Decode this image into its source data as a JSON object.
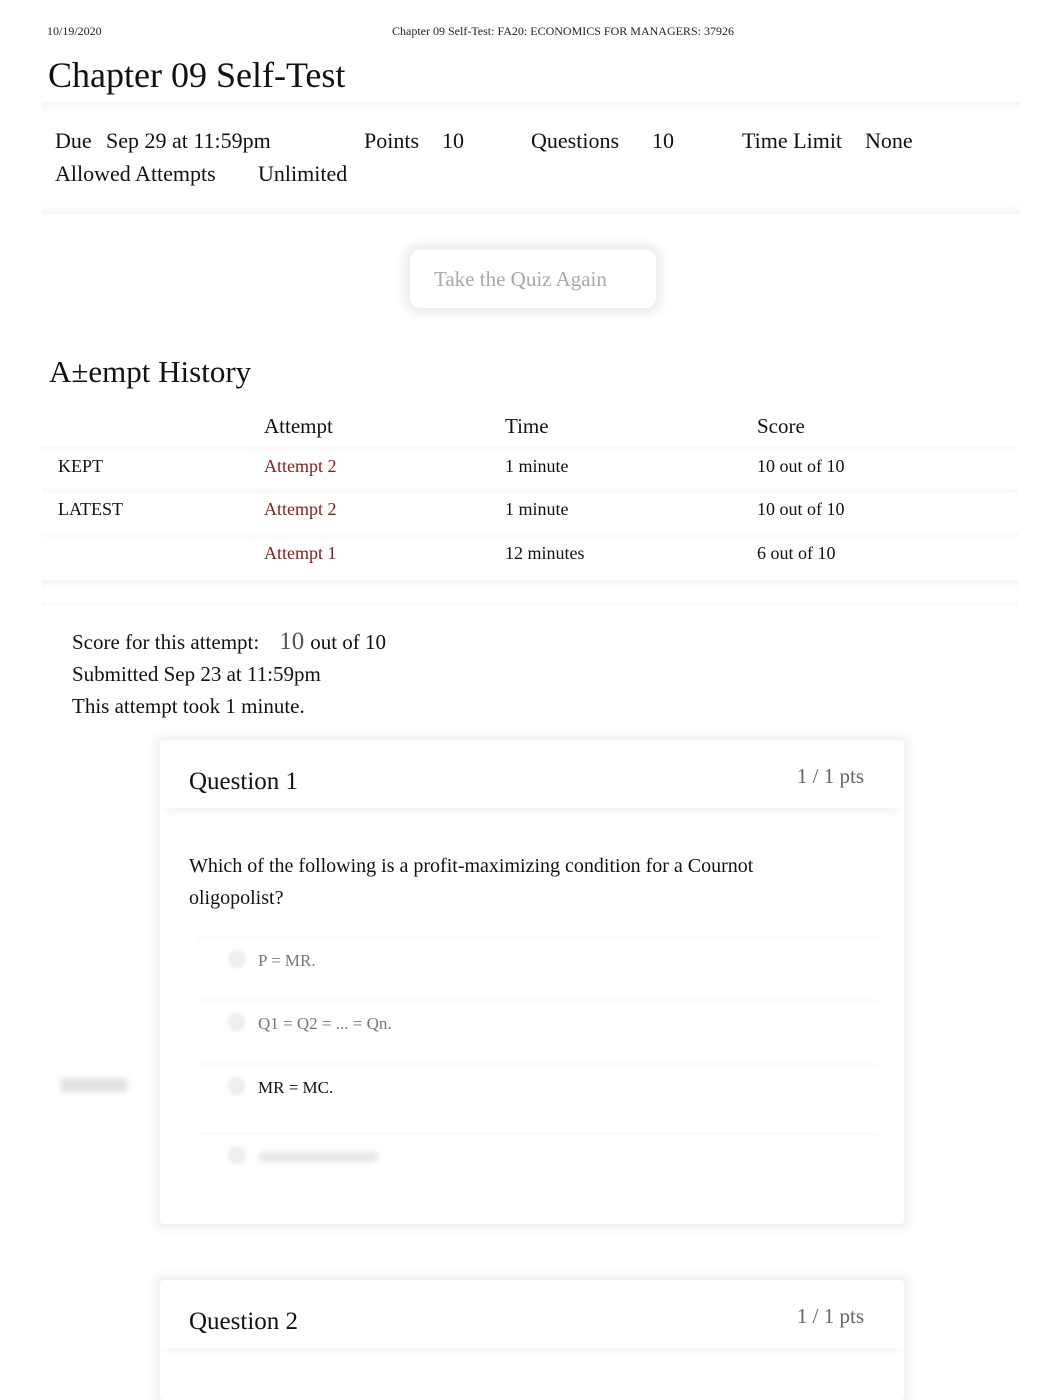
{
  "print_header": {
    "date": "10/19/2020",
    "title": "Chapter 09 Self-Test: FA20: ECONOMICS FOR MANAGERS: 37926"
  },
  "quiz": {
    "title": "Chapter 09 Self-Test",
    "details": {
      "due_label": "Due",
      "due_value": "Sep 29 at 11:59pm",
      "points_label": "Points",
      "points_value": "10",
      "questions_label": "Questions",
      "questions_value": "10",
      "time_limit_label": "Time Limit",
      "time_limit_value": "None",
      "allowed_attempts_label": "Allowed Attempts",
      "allowed_attempts_value": "Unlimited"
    },
    "take_again_label": "Take the Quiz Again"
  },
  "attempt_history": {
    "title": "A±empt History",
    "columns": [
      "Attempt",
      "Time",
      "Score"
    ],
    "rows": [
      {
        "tag": "KEPT",
        "attempt": "Attempt 2",
        "time": "1 minute",
        "score": "10 out of 10"
      },
      {
        "tag": "LATEST",
        "attempt": "Attempt 2",
        "time": "1 minute",
        "score": "10 out of 10"
      },
      {
        "tag": "",
        "attempt": "Attempt 1",
        "time": "12 minutes",
        "score": "6 out of 10"
      }
    ]
  },
  "attempt_summary": {
    "score_label": "Score for this attempt:",
    "score_value": "10",
    "score_suffix": "out of 10",
    "submitted": "Submitted Sep 23 at 11:59pm",
    "duration": "This attempt took 1 minute."
  },
  "questions": [
    {
      "title": "Question 1",
      "points": "1 / 1 pts",
      "text": "Which of the following is a profit-maximizing condition for a Cournot oligopolist?",
      "answers": [
        {
          "label": "P = MR.",
          "selected": false
        },
        {
          "label": "Q1 = Q2 = ... = Qn.",
          "selected": false
        },
        {
          "label": "MR = MC.",
          "selected": true
        },
        {
          "label": "",
          "selected": false
        }
      ]
    },
    {
      "title": "Question 2",
      "points": "1 / 1 pts"
    }
  ]
}
